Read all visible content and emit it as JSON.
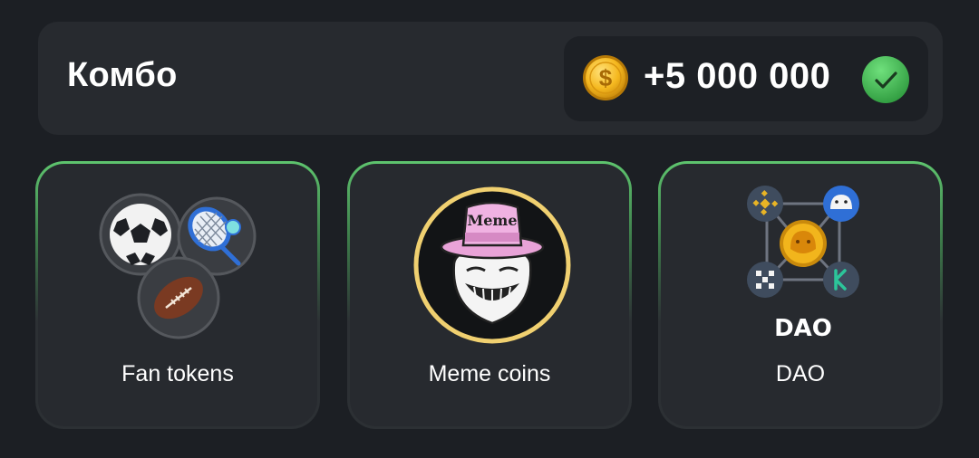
{
  "combo": {
    "title": "Комбо",
    "reward_amount": "+5 000 000",
    "coin_icon": "gold-coin-icon",
    "status_icon": "check-circle-icon",
    "colors": {
      "panel": "#272a2f",
      "pill": "#1d2025",
      "check": "#3fb34f",
      "coin": "#f2b51c"
    }
  },
  "cards": [
    {
      "label": "Fan tokens",
      "icon": "sports-balls-icon"
    },
    {
      "label": "Meme coins",
      "icon": "troll-face-meme-icon",
      "hat_text": "Meme"
    },
    {
      "label": "DAO",
      "icon": "dao-network-icon",
      "logo_text": "DAO"
    }
  ],
  "theme": {
    "background": "#1c1f24",
    "card_border_accent": "#5ec46e"
  }
}
